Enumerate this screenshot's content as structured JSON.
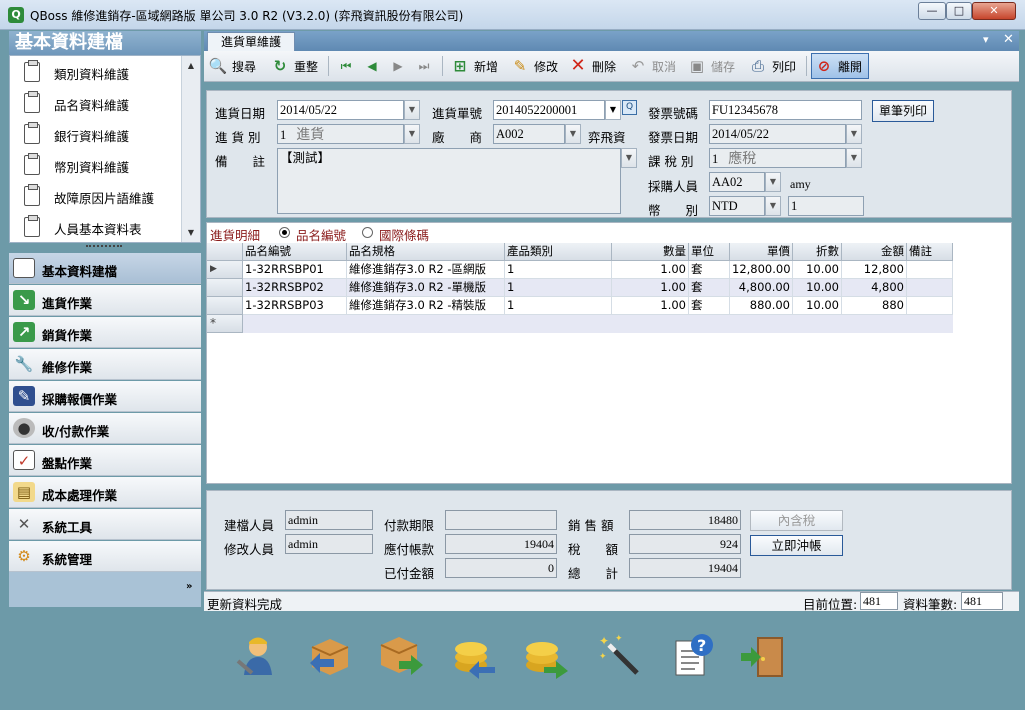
{
  "window": {
    "title": "QBoss 維修進銷存-區域網路版 單公司 3.0 R2 (V3.2.0) (弈飛資訊股份有限公司)",
    "minimize": "—",
    "maximize": "□",
    "close": "✕"
  },
  "left_panel": {
    "header": "基本資料建檔",
    "items": [
      "類別資料維護",
      "品名資料維護",
      "銀行資料維護",
      "幣別資料維護",
      "故障原因片語維護",
      "人員基本資料表"
    ],
    "nav": [
      {
        "label": "基本資料建檔",
        "icon": "document-icon"
      },
      {
        "label": "進貨作業",
        "icon": "import-icon"
      },
      {
        "label": "銷貨作業",
        "icon": "export-icon"
      },
      {
        "label": "維修作業",
        "icon": "wrench-icon"
      },
      {
        "label": "採購報價作業",
        "icon": "quote-icon"
      },
      {
        "label": "收/付款作業",
        "icon": "coin-icon"
      },
      {
        "label": "盤點作業",
        "icon": "checklist-icon"
      },
      {
        "label": "成本處理作業",
        "icon": "cost-icon"
      },
      {
        "label": "系統工具",
        "icon": "tools-icon"
      },
      {
        "label": "系統管理",
        "icon": "gears-icon"
      }
    ],
    "more": "»"
  },
  "tab": {
    "label": "進貨單維護",
    "pin": "▾",
    "close": "✕"
  },
  "toolbar": {
    "search": "搜尋",
    "reset": "重整",
    "add": "新增",
    "edit": "修改",
    "delete": "刪除",
    "cancel": "取消",
    "save": "儲存",
    "print": "列印",
    "exit": "離開"
  },
  "form": {
    "purchase_date_label": "進貨日期",
    "purchase_date": "2014/05/22",
    "order_no_label": "進貨單號",
    "order_no": "2014052200001",
    "invoice_no_label": "發票號碼",
    "invoice_no": "FU12345678",
    "print_single": "單筆列印",
    "purchase_type_label": "進 貨 別",
    "purchase_type_code": "1",
    "purchase_type_name": "進貨",
    "vendor_label": "廠　　商",
    "vendor_code": "A002",
    "vendor_name": "弈飛資",
    "invoice_date_label": "發票日期",
    "invoice_date": "2014/05/22",
    "note_label": "備　　註",
    "note": "【測試】",
    "tax_type_label": "課 稅 別",
    "tax_type_code": "1",
    "tax_type_name": "應稅",
    "buyer_label": "採購人員",
    "buyer_code": "AA02",
    "buyer_name": "amy",
    "currency_label": "幣　　別",
    "currency": "NTD",
    "exchange_rate": "1"
  },
  "detail": {
    "title": "進貨明細",
    "radio_item_no": "品名編號",
    "radio_barcode": "國際條碼",
    "columns": [
      "品名編號",
      "品名規格",
      "產品類別",
      "數量",
      "單位",
      "單價",
      "折數",
      "金額",
      "備註"
    ],
    "rows": [
      {
        "item_no": "1-32RRSBP01",
        "spec": "維修進銷存3.0 R2 -區網版",
        "category": "1",
        "qty": "1.00",
        "unit": "套",
        "price": "12,800.00",
        "discount": "10.00",
        "amount": "12,800",
        "note": ""
      },
      {
        "item_no": "1-32RRSBP02",
        "spec": "維修進銷存3.0 R2 -單機版",
        "category": "1",
        "qty": "1.00",
        "unit": "套",
        "price": "4,800.00",
        "discount": "10.00",
        "amount": "4,800",
        "note": ""
      },
      {
        "item_no": "1-32RRSBP03",
        "spec": "維修進銷存3.0 R2 -精裝版",
        "category": "1",
        "qty": "1.00",
        "unit": "套",
        "price": "880.00",
        "discount": "10.00",
        "amount": "880",
        "note": ""
      }
    ],
    "new_row_marker": "*",
    "current_row_marker": "▶"
  },
  "footer": {
    "creator_label": "建檔人員",
    "creator": "admin",
    "modifier_label": "修改人員",
    "modifier": "admin",
    "pay_term_label": "付款期限",
    "pay_term": "",
    "payable_label": "應付帳款",
    "payable": "19404",
    "paid_label": "已付金額",
    "paid": "0",
    "sales_label": "銷 售 額",
    "sales": "18480",
    "tax_label": "稅　　額",
    "tax": "924",
    "total_label": "總　　計",
    "total": "19404",
    "tax_incl_btn": "內含稅",
    "settle_btn": "立即沖帳"
  },
  "status": {
    "message": "更新資料完成",
    "position_label": "目前位置:",
    "position": "481",
    "count_label": "資料筆數:",
    "count": "481"
  },
  "bottom_icons": [
    "support-person-icon",
    "purchase-box-icon",
    "sales-box-icon",
    "receive-coins-icon",
    "pay-coins-icon",
    "magic-wand-icon",
    "help-document-icon",
    "exit-door-icon"
  ]
}
